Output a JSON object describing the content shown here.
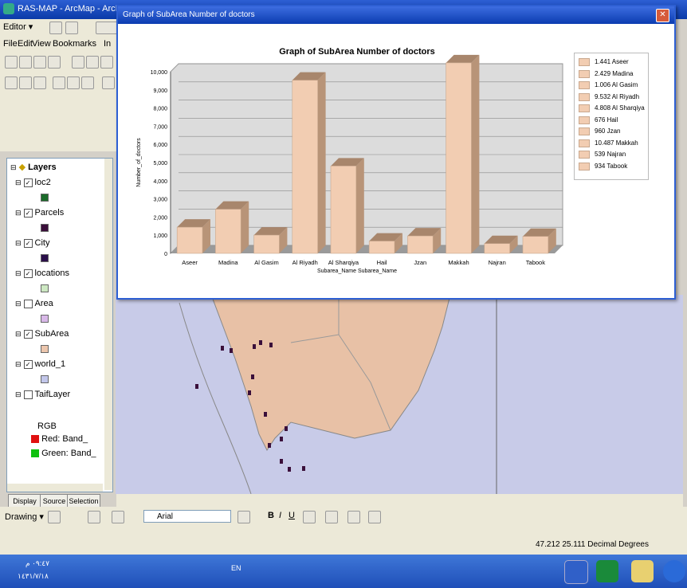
{
  "app": {
    "title": "RAS-MAP - ArcMap - ArcInfo",
    "menus": [
      "File",
      "Edit",
      "View",
      "Bookmarks",
      "In"
    ],
    "editor_label": "Editor ▾"
  },
  "toc": {
    "header": "Layers",
    "layers": [
      {
        "name": "loc2",
        "checked": true,
        "symbol_color": "#1b6b2a"
      },
      {
        "name": "Parcels",
        "checked": true,
        "symbol_color": "#3a0f3a"
      },
      {
        "name": "City",
        "checked": true,
        "symbol_color": "#2a0f4a"
      },
      {
        "name": "locations",
        "checked": true,
        "symbol_color": "#cde8c2"
      },
      {
        "name": "Area",
        "checked": false,
        "symbol_color": "#d8b8e8"
      },
      {
        "name": "SubArea",
        "checked": true,
        "symbol_color": "#ecc6ad"
      },
      {
        "name": "world_1",
        "checked": true,
        "symbol_color": "#c2c6ea"
      },
      {
        "name": "TaifLayer",
        "checked": false,
        "symbol_color": ""
      }
    ],
    "rgb_label": "RGB",
    "bands": [
      {
        "label": "Red: Band_",
        "color": "#e01010"
      },
      {
        "label": "Green: Band_",
        "color": "#10c010"
      }
    ],
    "tabs": [
      "Display",
      "Source",
      "Selection"
    ]
  },
  "chart_window": {
    "title": "Graph of SubArea Number of doctors"
  },
  "chart_data": {
    "type": "bar",
    "title": "Graph of SubArea Number of doctors",
    "xlabel": "Subarea_Name Subarea_Name",
    "ylabel": "Number_of_doctors",
    "categories": [
      "Aseer",
      "Madina",
      "Al Gasim",
      "Al Riyadh",
      "Al Sharqiya",
      "Hail",
      "Jzan",
      "Makkah",
      "Najran",
      "Tabook"
    ],
    "values": [
      1441,
      2429,
      1006,
      9532,
      4808,
      676,
      960,
      10487,
      539,
      934
    ],
    "ylim": [
      0,
      10000
    ],
    "yticks": [
      "0",
      "1,000",
      "2,000",
      "3,000",
      "4,000",
      "5,000",
      "6,000",
      "7,000",
      "8,000",
      "9,000",
      "10,000"
    ],
    "legend": [
      "1.441 Aseer",
      "2.429 Madina",
      "1.006 Al Gasim",
      "9.532 Al Riyadh",
      "4.808 Al Sharqiya",
      "676 Hail",
      "960 Jzan",
      "10.487 Makkah",
      "539 Najran",
      "934 Tabook"
    ],
    "legend_position": "right",
    "bar_color": "#f2cdb2",
    "grid": true
  },
  "drawing": {
    "label": "Drawing ▾",
    "font_name": "Arial"
  },
  "status": {
    "coords": "47.212  25.111 Decimal Degrees"
  },
  "taskbar": {
    "time": "٠٩:٤٧ م",
    "date": "١٤٣١/٧/١٨",
    "lang": "EN"
  }
}
